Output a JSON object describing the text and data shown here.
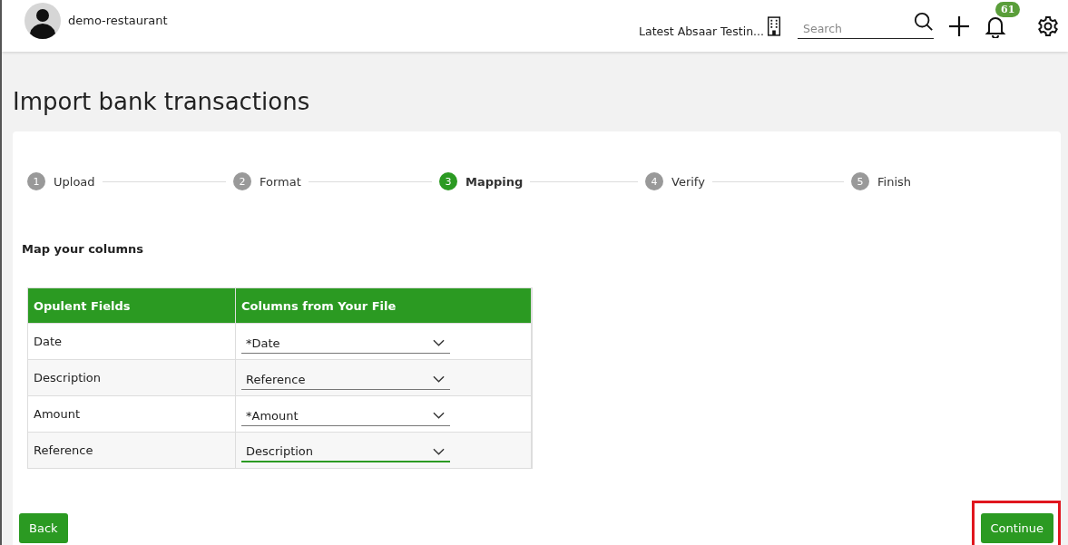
{
  "header": {
    "org_name": "demo-restaurant",
    "company_name": "Latest Absaar Testin...",
    "search": {
      "placeholder": "Search"
    },
    "notification_count": "61"
  },
  "page_title": "Import bank transactions",
  "steps": [
    {
      "number": "1",
      "label": "Upload",
      "selected": false
    },
    {
      "number": "2",
      "label": "Format",
      "selected": false
    },
    {
      "number": "3",
      "label": "Mapping",
      "selected": true
    },
    {
      "number": "4",
      "label": "Verify",
      "selected": false
    },
    {
      "number": "5",
      "label": "Finish",
      "selected": false
    }
  ],
  "mapping": {
    "heading": "Map your columns",
    "columns": [
      "Opulent Fields",
      "Columns from Your File"
    ],
    "rows": [
      {
        "field": "Date",
        "value": "*Date",
        "focused": false
      },
      {
        "field": "Description",
        "value": "Reference",
        "focused": false
      },
      {
        "field": "Amount",
        "value": "*Amount",
        "focused": false
      },
      {
        "field": "Reference",
        "value": "Description",
        "focused": true
      }
    ]
  },
  "buttons": [
    {
      "label": "Back",
      "highlighted": false
    },
    {
      "label": "Continue",
      "highlighted": true
    }
  ]
}
